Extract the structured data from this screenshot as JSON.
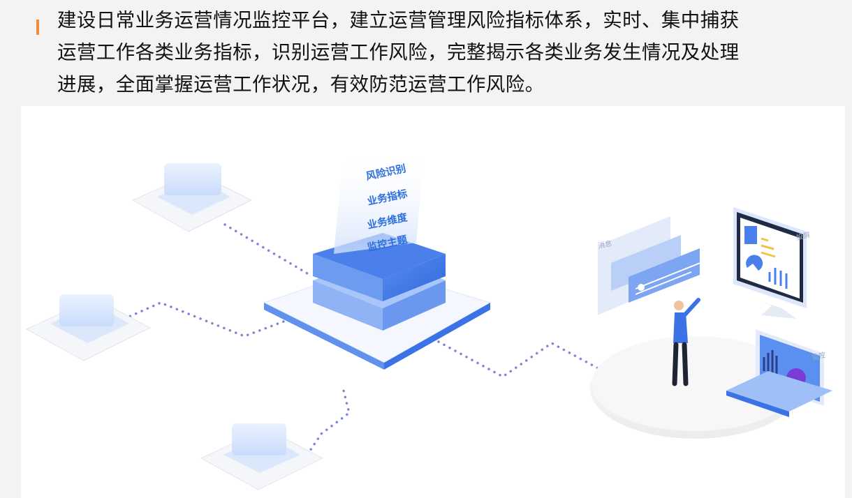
{
  "intro": {
    "lines": [
      "建设日常业务运营情况监控平台，建立运营管理风险指标体系，实时、集中捕获",
      "运营工作各类业务指标，识别运营工作风险，完整揭示各类业务发生情况及处理",
      "进展，全面掌握运营工作状况，有效防范运营工作风险。"
    ]
  },
  "platform": {
    "tiers": [
      "风险识别",
      "业务指标",
      "业务维度",
      "监控主题"
    ]
  },
  "screens": {
    "message": "消息",
    "big_screen": "投屏",
    "monitor": "监控"
  },
  "colors": {
    "accent": "#f08a3c",
    "primary_blue": "#3b73e6",
    "light_blue": "#9fc0f7",
    "dot_purple": "#7a86d8"
  }
}
